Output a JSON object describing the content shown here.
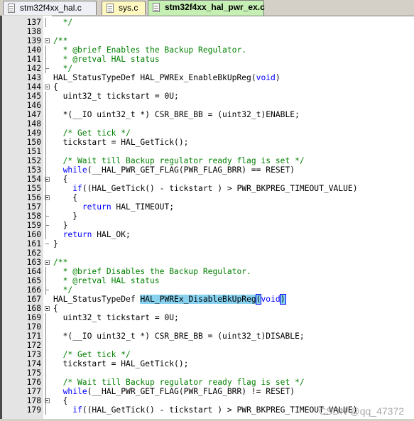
{
  "tabs": [
    {
      "label": "stm32f4xx_hal.c",
      "icon": "c-file-icon",
      "active": false
    },
    {
      "label": "sys.c",
      "icon": "c-file-icon",
      "active": false
    },
    {
      "label": "stm32f4xx_hal_pwr_ex.c",
      "icon": "c-file-icon",
      "active": true
    }
  ],
  "editor": {
    "lines": [
      {
        "n": "137",
        "code": "  */"
      },
      {
        "n": "138",
        "code": ""
      },
      {
        "n": "139",
        "code": "/**"
      },
      {
        "n": "140",
        "code": "  * @brief Enables the Backup Regulator."
      },
      {
        "n": "141",
        "code": "  * @retval HAL status"
      },
      {
        "n": "142",
        "code": "  */"
      },
      {
        "n": "143",
        "code": "HAL_StatusTypeDef HAL_PWREx_EnableBkUpReg(void)"
      },
      {
        "n": "144",
        "code": "{"
      },
      {
        "n": "145",
        "code": "  uint32_t tickstart = 0U;"
      },
      {
        "n": "146",
        "code": ""
      },
      {
        "n": "147",
        "code": "  *(__IO uint32_t *) CSR_BRE_BB = (uint32_t)ENABLE;"
      },
      {
        "n": "148",
        "code": ""
      },
      {
        "n": "149",
        "code": "  /* Get tick */"
      },
      {
        "n": "150",
        "code": "  tickstart = HAL_GetTick();"
      },
      {
        "n": "151",
        "code": ""
      },
      {
        "n": "152",
        "code": "  /* Wait till Backup regulator ready flag is set */"
      },
      {
        "n": "153",
        "code": "  while(__HAL_PWR_GET_FLAG(PWR_FLAG_BRR) == RESET)"
      },
      {
        "n": "154",
        "code": "  {"
      },
      {
        "n": "155",
        "code": "    if((HAL_GetTick() - tickstart ) > PWR_BKPREG_TIMEOUT_VALUE)"
      },
      {
        "n": "156",
        "code": "    {"
      },
      {
        "n": "157",
        "code": "      return HAL_TIMEOUT;"
      },
      {
        "n": "158",
        "code": "    }"
      },
      {
        "n": "159",
        "code": "  }"
      },
      {
        "n": "160",
        "code": "  return HAL_OK;"
      },
      {
        "n": "161",
        "code": "}"
      },
      {
        "n": "162",
        "code": ""
      },
      {
        "n": "163",
        "code": "/**"
      },
      {
        "n": "164",
        "code": "  * @brief Disables the Backup Regulator."
      },
      {
        "n": "165",
        "code": "  * @retval HAL status"
      },
      {
        "n": "166",
        "code": "  */"
      },
      {
        "n": "167",
        "code": "HAL_StatusTypeDef HAL_PWREx_DisableBkUpReg(void)"
      },
      {
        "n": "168",
        "code": "{"
      },
      {
        "n": "169",
        "code": "  uint32_t tickstart = 0U;"
      },
      {
        "n": "170",
        "code": ""
      },
      {
        "n": "171",
        "code": "  *(__IO uint32_t *) CSR_BRE_BB = (uint32_t)DISABLE;"
      },
      {
        "n": "172",
        "code": ""
      },
      {
        "n": "173",
        "code": "  /* Get tick */"
      },
      {
        "n": "174",
        "code": "  tickstart = HAL_GetTick();"
      },
      {
        "n": "175",
        "code": ""
      },
      {
        "n": "176",
        "code": "  /* Wait till Backup regulator ready flag is set */"
      },
      {
        "n": "177",
        "code": "  while(__HAL_PWR_GET_FLAG(PWR_FLAG_BRR) != RESET)"
      },
      {
        "n": "178",
        "code": "  {"
      },
      {
        "n": "179",
        "code": "    if((HAL_GetTick() - tickstart ) > PWR_BKPREG_TIMEOUT_VALUE)"
      }
    ],
    "highlighted_symbol": "HAL_PWREx_DisableBkUpReg"
  },
  "watermark": "CSDN @qq_47372"
}
